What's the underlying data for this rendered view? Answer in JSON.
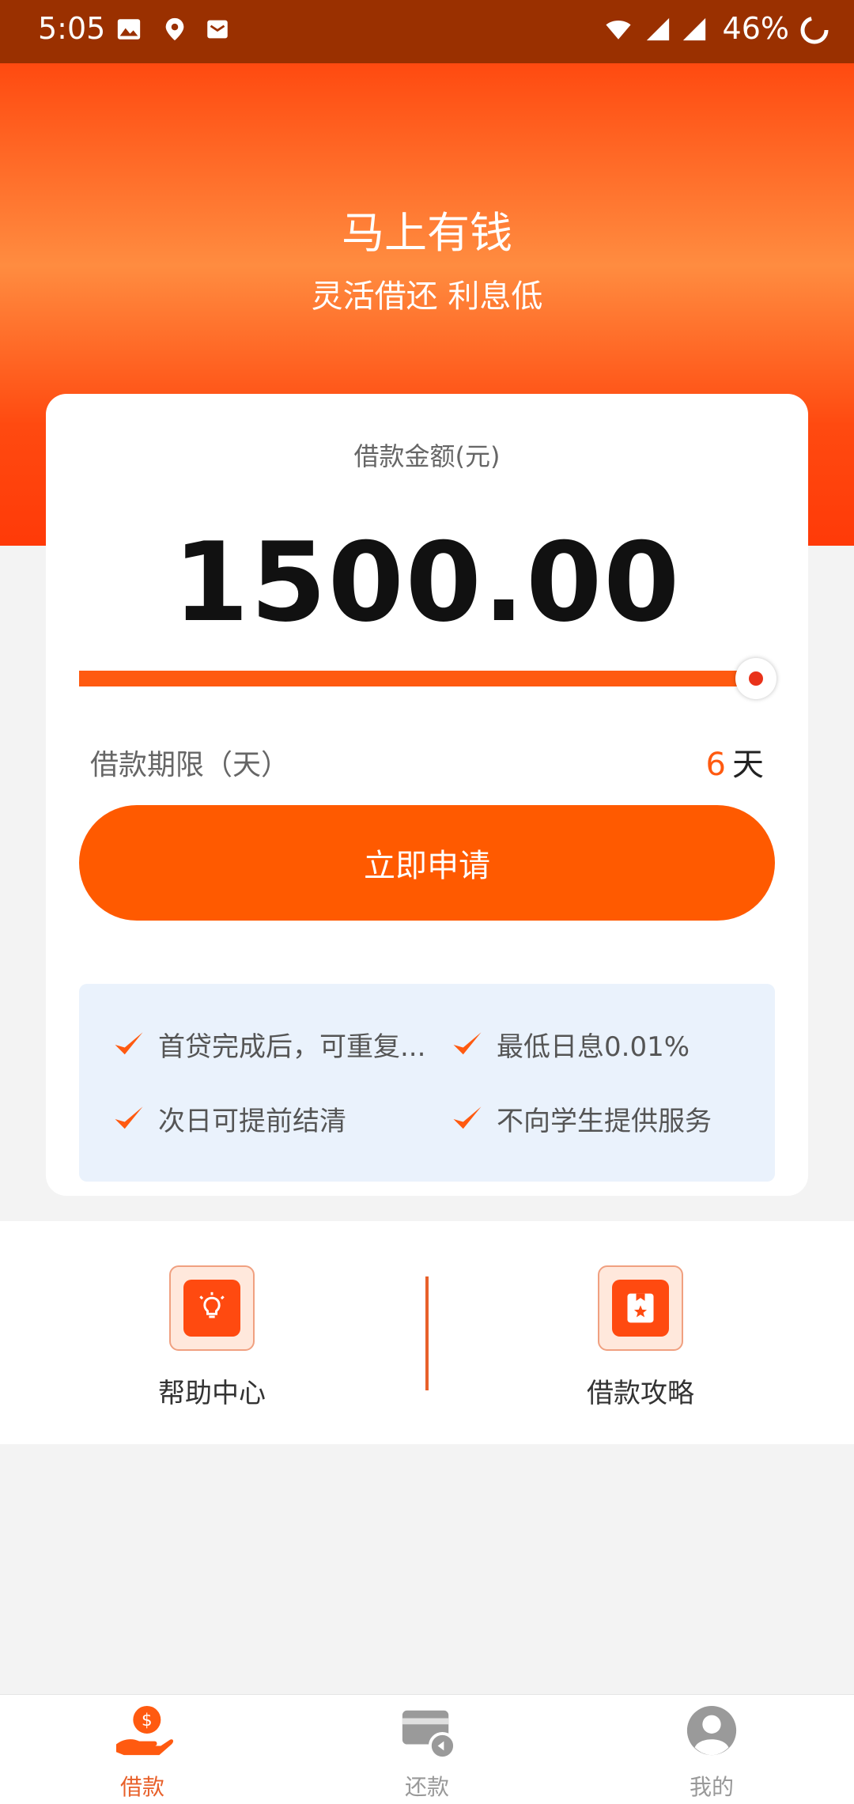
{
  "status_bar": {
    "time": "5:05",
    "battery": "46%",
    "icons": [
      "image-icon",
      "location-icon",
      "mail-icon",
      "wifi-icon",
      "signal-icon",
      "signal-icon",
      "battery-icon"
    ]
  },
  "hero": {
    "title": "马上有钱",
    "subtitle": "灵活借还 利息低"
  },
  "loan_card": {
    "amount_label": "借款金额(元)",
    "amount_value": "1500.00",
    "slider_fraction": 1.0,
    "term_label": "借款期限（天）",
    "term_number": "6",
    "term_unit": "天",
    "apply_button": "立即申请",
    "features": [
      "首贷完成后，可重复...",
      "最低日息0.01%",
      "次日可提前结清",
      "不向学生提供服务"
    ]
  },
  "shortcuts": [
    {
      "label": "帮助中心",
      "icon": "lightbulb-icon"
    },
    {
      "label": "借款攻略",
      "icon": "bookmark-star-icon"
    }
  ],
  "bottom_nav": [
    {
      "label": "借款",
      "icon": "loan-hand-icon",
      "active": true
    },
    {
      "label": "还款",
      "icon": "repay-card-icon",
      "active": false
    },
    {
      "label": "我的",
      "icon": "profile-icon",
      "active": false
    }
  ],
  "colors": {
    "accent": "#ff5a00",
    "status_bar": "#9a3000",
    "nav_active": "#e8602a",
    "nav_inactive": "#999999"
  }
}
